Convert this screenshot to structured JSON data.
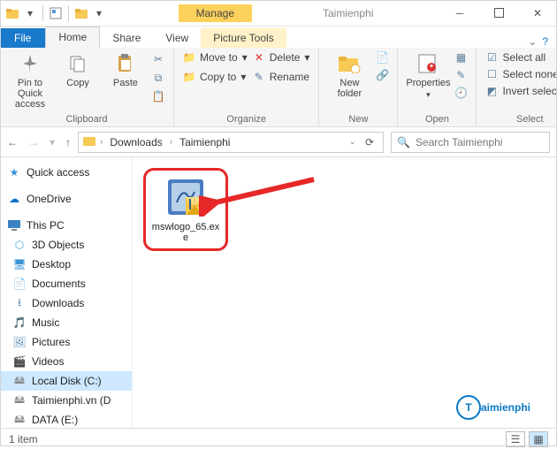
{
  "titlebar": {
    "context_tab": "Manage",
    "window_title": "Taimienphi"
  },
  "tabs": {
    "file": "File",
    "home": "Home",
    "share": "Share",
    "view": "View",
    "picture": "Picture Tools"
  },
  "ribbon": {
    "clipboard": {
      "pin": "Pin to Quick\naccess",
      "copy": "Copy",
      "paste": "Paste",
      "label": "Clipboard"
    },
    "organize": {
      "move": "Move to",
      "copy": "Copy to",
      "del": "Delete",
      "rename": "Rename",
      "label": "Organize"
    },
    "new": {
      "newfolder": "New\nfolder",
      "label": "New"
    },
    "open": {
      "properties": "Properties",
      "label": "Open"
    },
    "select": {
      "all": "Select all",
      "none": "Select none",
      "invert": "Invert selection",
      "label": "Select"
    }
  },
  "address": {
    "crumb1": "Downloads",
    "crumb2": "Taimienphi",
    "search_placeholder": "Search Taimienphi"
  },
  "sidebar": {
    "quick": "Quick access",
    "onedrive": "OneDrive",
    "thispc": "This PC",
    "objects": "3D Objects",
    "desktop": "Desktop",
    "documents": "Documents",
    "downloads": "Downloads",
    "music": "Music",
    "pictures": "Pictures",
    "videos": "Videos",
    "localc": "Local Disk (C:)",
    "taim": "Taimienphi.vn (D",
    "datae": "DATA (E:)"
  },
  "content": {
    "file1": "mswlogo_65.exe"
  },
  "status": {
    "count": "1 item"
  },
  "watermark": {
    "rest": "aimienphi"
  }
}
